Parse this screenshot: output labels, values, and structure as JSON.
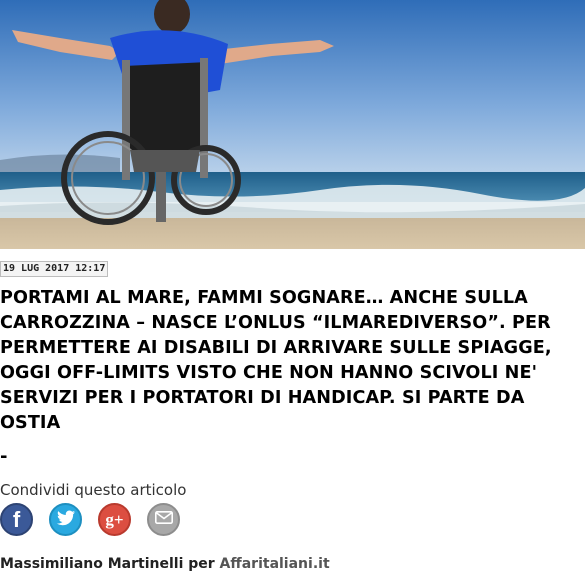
{
  "article": {
    "hero_image": "man-in-wheelchair-on-beach-photo",
    "date": "19 LUG 2017 12:17",
    "headline": "PORTAMI AL MARE, FAMMI SOGNARE… ANCHE SULLA CARROZZINA – NASCE L’ONLUS “ILMAREDIVERSO”. PER PERMETTERE AI DISABILI DI ARRIVARE SULLE SPIAGGE, OGGI OFF-LIMITS VISTO CHE NON HANNO SCIVOLI NE' SERVIZI PER I PORTATORI DI HANDICAP. SI PARTE DA OSTIA",
    "separator": "-"
  },
  "share": {
    "label": "Condividi questo articolo",
    "buttons": [
      {
        "icon": "facebook-icon",
        "glyph": "f",
        "color": "#3b5998"
      },
      {
        "icon": "twitter-icon",
        "glyph": "🐦",
        "color": "#2aa9e0"
      },
      {
        "icon": "google-plus-icon",
        "glyph": "g+",
        "color": "#dc4e41"
      },
      {
        "icon": "email-icon",
        "glyph": "✉",
        "color": "#a8a8a8"
      }
    ]
  },
  "byline": {
    "author": "Massimiliano Martinelli per ",
    "source": "Affaritaliani.it"
  }
}
